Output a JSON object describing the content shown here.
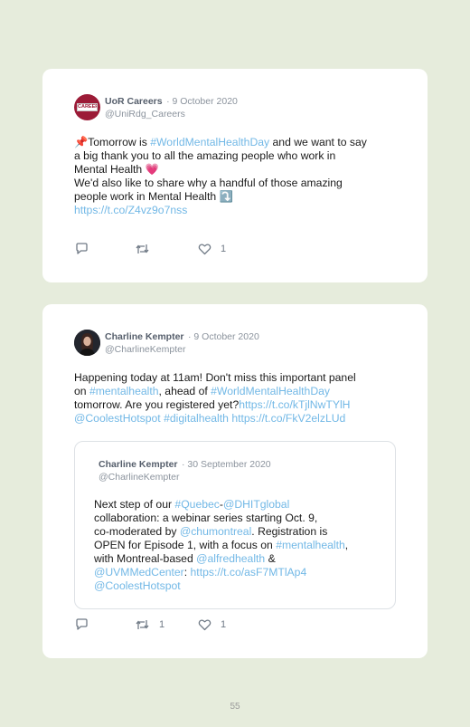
{
  "posts": [
    {
      "author": "UoR Careers",
      "date": "· 9 October 2020",
      "handle": "@UniRdg_Careers",
      "avatar_text": "CAREERS",
      "lines": [
        [
          {
            "t": "📌Tomorrow is "
          },
          {
            "t": "#WorldMentalHealthDay",
            "link": true
          },
          {
            "t": " and we want to say"
          }
        ],
        [
          {
            "t": "a big thank you to all the amazing people who work in"
          }
        ],
        [
          {
            "t": "Mental Health 💗"
          }
        ],
        [
          {
            "t": "We'd also like to share why a handful of those amazing"
          }
        ],
        [
          {
            "t": "people work in Mental Health ⤵️"
          }
        ],
        [
          {
            "t": "https://t.co/Z4vz9o7nss",
            "link": true
          }
        ]
      ],
      "reply_count": "",
      "retweet_count": "",
      "like_count": "1"
    },
    {
      "author": "Charline Kempter",
      "date": "· 9 October 2020",
      "handle": "@CharlineKempter",
      "lines": [
        [
          {
            "t": "Happening today at 11am! Don't miss this important panel"
          }
        ],
        [
          {
            "t": "on "
          },
          {
            "t": "#mentalhealth",
            "link": true
          },
          {
            "t": ", ahead of "
          },
          {
            "t": "#WorldMentalHealthDay",
            "link": true
          }
        ],
        [
          {
            "t": "tomorrow. Are you registered yet?"
          },
          {
            "t": "https://t.co/kTjlNwTYlH",
            "link": true
          }
        ],
        [
          {
            "t": "@CoolestHotspot",
            "link": true
          },
          {
            "t": " "
          },
          {
            "t": "#digitalhealth",
            "link": true
          },
          {
            "t": " "
          },
          {
            "t": "https://t.co/FkV2elzLUd",
            "link": true
          }
        ]
      ],
      "quote": {
        "author": "Charline Kempter",
        "date": "· 30 September 2020",
        "handle": "@CharlineKempter",
        "lines": [
          [
            {
              "t": "Next step of our "
            },
            {
              "t": "#Quebec",
              "link": true
            },
            {
              "t": "-"
            },
            {
              "t": "@DHITglobal",
              "link": true
            }
          ],
          [
            {
              "t": "collaboration: a webinar series starting Oct. 9,"
            }
          ],
          [
            {
              "t": "co-moderated by "
            },
            {
              "t": "@chumontreal",
              "link": true
            },
            {
              "t": ". Registration is"
            }
          ],
          [
            {
              "t": "OPEN for Episode 1, with a focus on "
            },
            {
              "t": "#mentalhealth",
              "link": true
            },
            {
              "t": ","
            }
          ],
          [
            {
              "t": "with Montreal-based "
            },
            {
              "t": "@alfredhealth",
              "link": true
            },
            {
              "t": " &"
            }
          ],
          [
            {
              "t": "@UVMMedCenter",
              "link": true
            },
            {
              "t": ": "
            },
            {
              "t": "https://t.co/asF7MTlAp4",
              "link": true
            }
          ],
          [
            {
              "t": "@CoolestHotspot",
              "link": true
            }
          ]
        ]
      },
      "reply_count": "",
      "retweet_count": "1",
      "like_count": "1"
    }
  ],
  "page_number": "55",
  "colors": {
    "background": "#e6ecdc",
    "card": "#ffffff",
    "link": "#72b8e6",
    "meta": "#8b939d",
    "author": "#555e6b",
    "uor_brand": "#9c1b37"
  },
  "icons": [
    "reply-icon",
    "retweet-icon",
    "like-icon"
  ]
}
